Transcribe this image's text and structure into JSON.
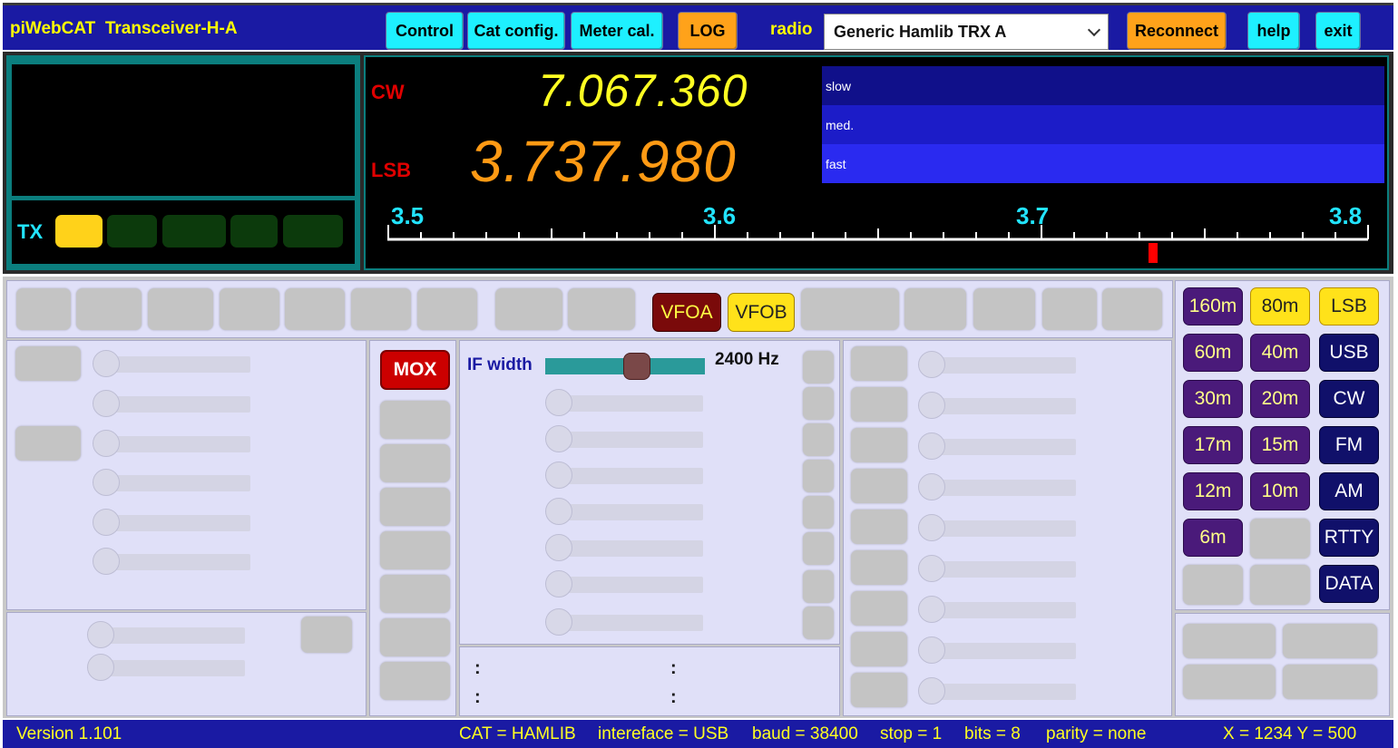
{
  "app": {
    "title": "piWebCAT  Transceiver-H-A"
  },
  "toolbar": {
    "control": "Control",
    "cat_config": "Cat config.",
    "meter_cal": "Meter cal.",
    "log": "LOG",
    "radio_label": "radio",
    "radio_value": "Generic Hamlib TRX A",
    "reconnect": "Reconnect",
    "help": "help",
    "exit": "exit"
  },
  "display": {
    "tx_label": "TX",
    "mode_a": "CW",
    "freq_a": "7.067.360",
    "mode_b": "LSB",
    "freq_b": "3.737.980",
    "speeds": [
      "slow",
      "med.",
      "fast"
    ],
    "scale_labels": [
      "3.5",
      "3.6",
      "3.7",
      "3.8"
    ]
  },
  "vfo": {
    "a": "VFOA",
    "b": "VFOB"
  },
  "mox": "MOX",
  "ifwidth": {
    "label": "IF width",
    "value": "2400 Hz"
  },
  "bands": [
    "160m",
    "80m",
    "60m",
    "40m",
    "30m",
    "20m",
    "17m",
    "15m",
    "12m",
    "10m",
    "6m"
  ],
  "modes": [
    "LSB",
    "USB",
    "CW",
    "FM",
    "AM",
    "RTTY",
    "DATA"
  ],
  "colons": [
    ":",
    ":",
    ":",
    ":"
  ],
  "status": {
    "version": "Version 1.101",
    "cat": "CAT = HAMLIB",
    "interface": "intereface = USB",
    "baud": "baud = 38400",
    "stop": "stop = 1",
    "bits": "bits = 8",
    "parity": "parity = none",
    "coords": "X = 1234 Y = 500"
  },
  "colors": {
    "topbar": "#1a1aa3",
    "accent_cyan": "#1ef0ff",
    "accent_orange": "#ffa21a",
    "freq_a": "#ffff22",
    "freq_b": "#ff9a14"
  }
}
